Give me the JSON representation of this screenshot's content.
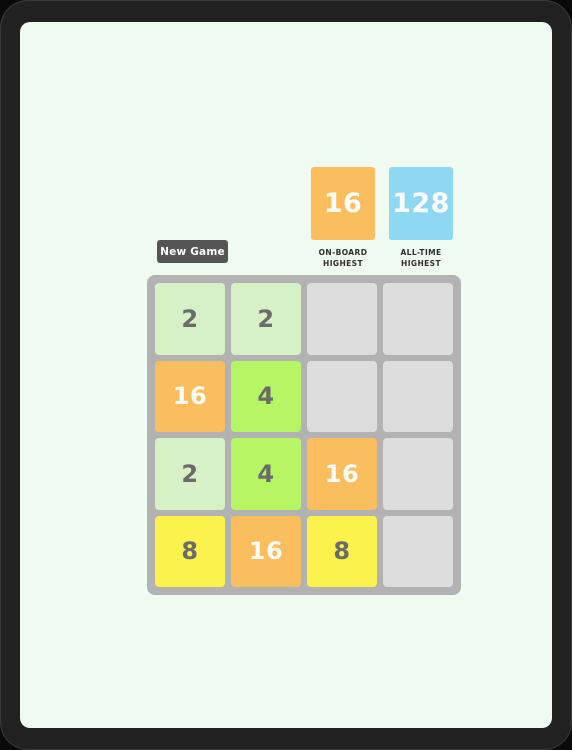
{
  "device": {
    "bezel_color": "#212121",
    "screen_background": "#effaf0"
  },
  "scores": {
    "onboard": {
      "value": "16",
      "label_line1": "ON-BOARD",
      "label_line2": "HIGHEST",
      "color": "#fbbe5e"
    },
    "alltime": {
      "value": "128",
      "label_line1": "ALL-TIME",
      "label_line2": "HIGHEST",
      "color": "#8ed8f4"
    }
  },
  "controls": {
    "new_game_label": "New Game",
    "new_game_color": "#555555"
  },
  "board": {
    "rows": 4,
    "cols": 4,
    "background": "#b2b2b2",
    "empty_cell_color": "#dddddd",
    "tiles": [
      [
        {
          "value": "2",
          "class": "v2"
        },
        {
          "value": "2",
          "class": "v2"
        },
        {
          "value": "",
          "class": "empty"
        },
        {
          "value": "",
          "class": "empty"
        }
      ],
      [
        {
          "value": "16",
          "class": "v16"
        },
        {
          "value": "4",
          "class": "v4"
        },
        {
          "value": "",
          "class": "empty"
        },
        {
          "value": "",
          "class": "empty"
        }
      ],
      [
        {
          "value": "2",
          "class": "v2"
        },
        {
          "value": "4",
          "class": "v4"
        },
        {
          "value": "16",
          "class": "v16"
        },
        {
          "value": "",
          "class": "empty"
        }
      ],
      [
        {
          "value": "8",
          "class": "v8"
        },
        {
          "value": "16",
          "class": "v16"
        },
        {
          "value": "8",
          "class": "v8"
        },
        {
          "value": "",
          "class": "empty"
        }
      ]
    ],
    "tile_colors": {
      "2": "#d8f0c6",
      "4": "#b6f564",
      "8": "#fbf24e",
      "16": "#fbbe5e",
      "128": "#8ed8f4"
    }
  }
}
